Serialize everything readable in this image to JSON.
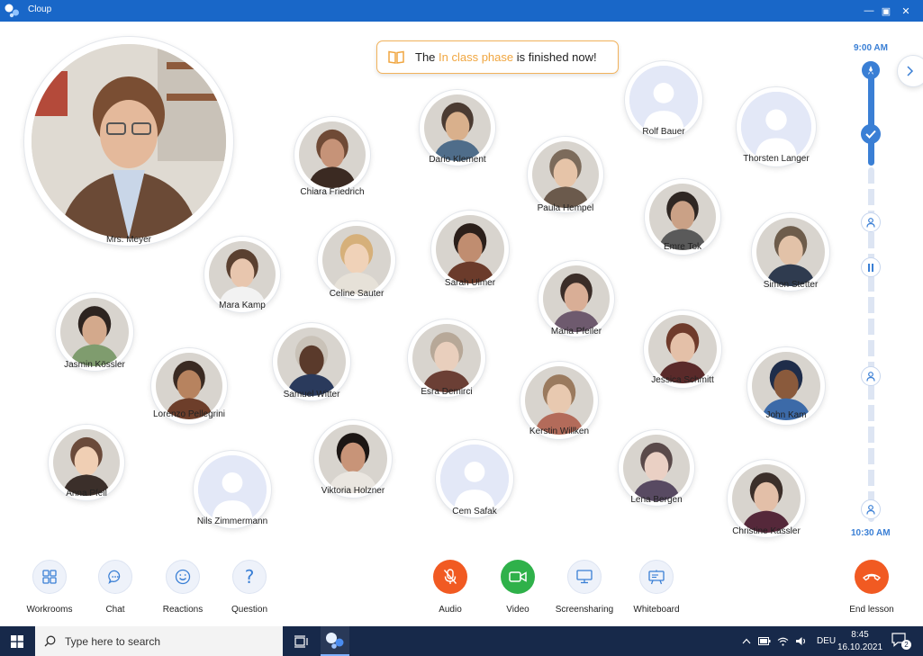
{
  "window": {
    "title": "Cloup",
    "minimize": "—",
    "maximize": "▣",
    "close": "✕"
  },
  "notice": {
    "prefix": "The ",
    "highlight": "In class phase",
    "suffix": " is finished now!"
  },
  "teacher": {
    "name": "Mrs. Meyer"
  },
  "participants": [
    {
      "name": "Chiara Friedrich"
    },
    {
      "name": "Dario Klement"
    },
    {
      "name": "Rolf Bauer"
    },
    {
      "name": "Thorsten Langer"
    },
    {
      "name": "Paula Hempel"
    },
    {
      "name": "Celine Sauter"
    },
    {
      "name": "Sarah Ulmer"
    },
    {
      "name": "Emre Tok"
    },
    {
      "name": "Simon Stetter"
    },
    {
      "name": "Mara Kamp"
    },
    {
      "name": "Maria Pfeiler"
    },
    {
      "name": "Jasmin Kössler"
    },
    {
      "name": "Samuel Witter"
    },
    {
      "name": "Esra Demirci"
    },
    {
      "name": "Jessica Schmitt"
    },
    {
      "name": "Lorenzo Pellegrini"
    },
    {
      "name": "Kerstin Willken"
    },
    {
      "name": "John Kam"
    },
    {
      "name": "Anna Pfeil"
    },
    {
      "name": "Viktoria Holzner"
    },
    {
      "name": "Nils Zimmermann"
    },
    {
      "name": "Cem Safak"
    },
    {
      "name": "Lena Bergen"
    },
    {
      "name": "Christine Kassler"
    }
  ],
  "timeline": {
    "start_time": "9:00 AM",
    "end_time": "10:30 AM"
  },
  "toolbar": {
    "workrooms": "Workrooms",
    "chat": "Chat",
    "reactions": "Reactions",
    "question": "Question",
    "audio": "Audio",
    "video": "Video",
    "screensharing": "Screensharing",
    "whiteboard": "Whiteboard",
    "end_lesson": "End lesson"
  },
  "taskbar": {
    "search_placeholder": "Type here to search",
    "language": "DEU",
    "time": "8:45",
    "date": "16.10.2021",
    "notifications": "2"
  },
  "colors": {
    "titlebar": "#1967c8",
    "accent_blue": "#3a7fd5",
    "highlight_orange": "#f0a640",
    "audio_red": "#f15a22",
    "video_green": "#2fb14a",
    "taskbar": "#17294a"
  }
}
